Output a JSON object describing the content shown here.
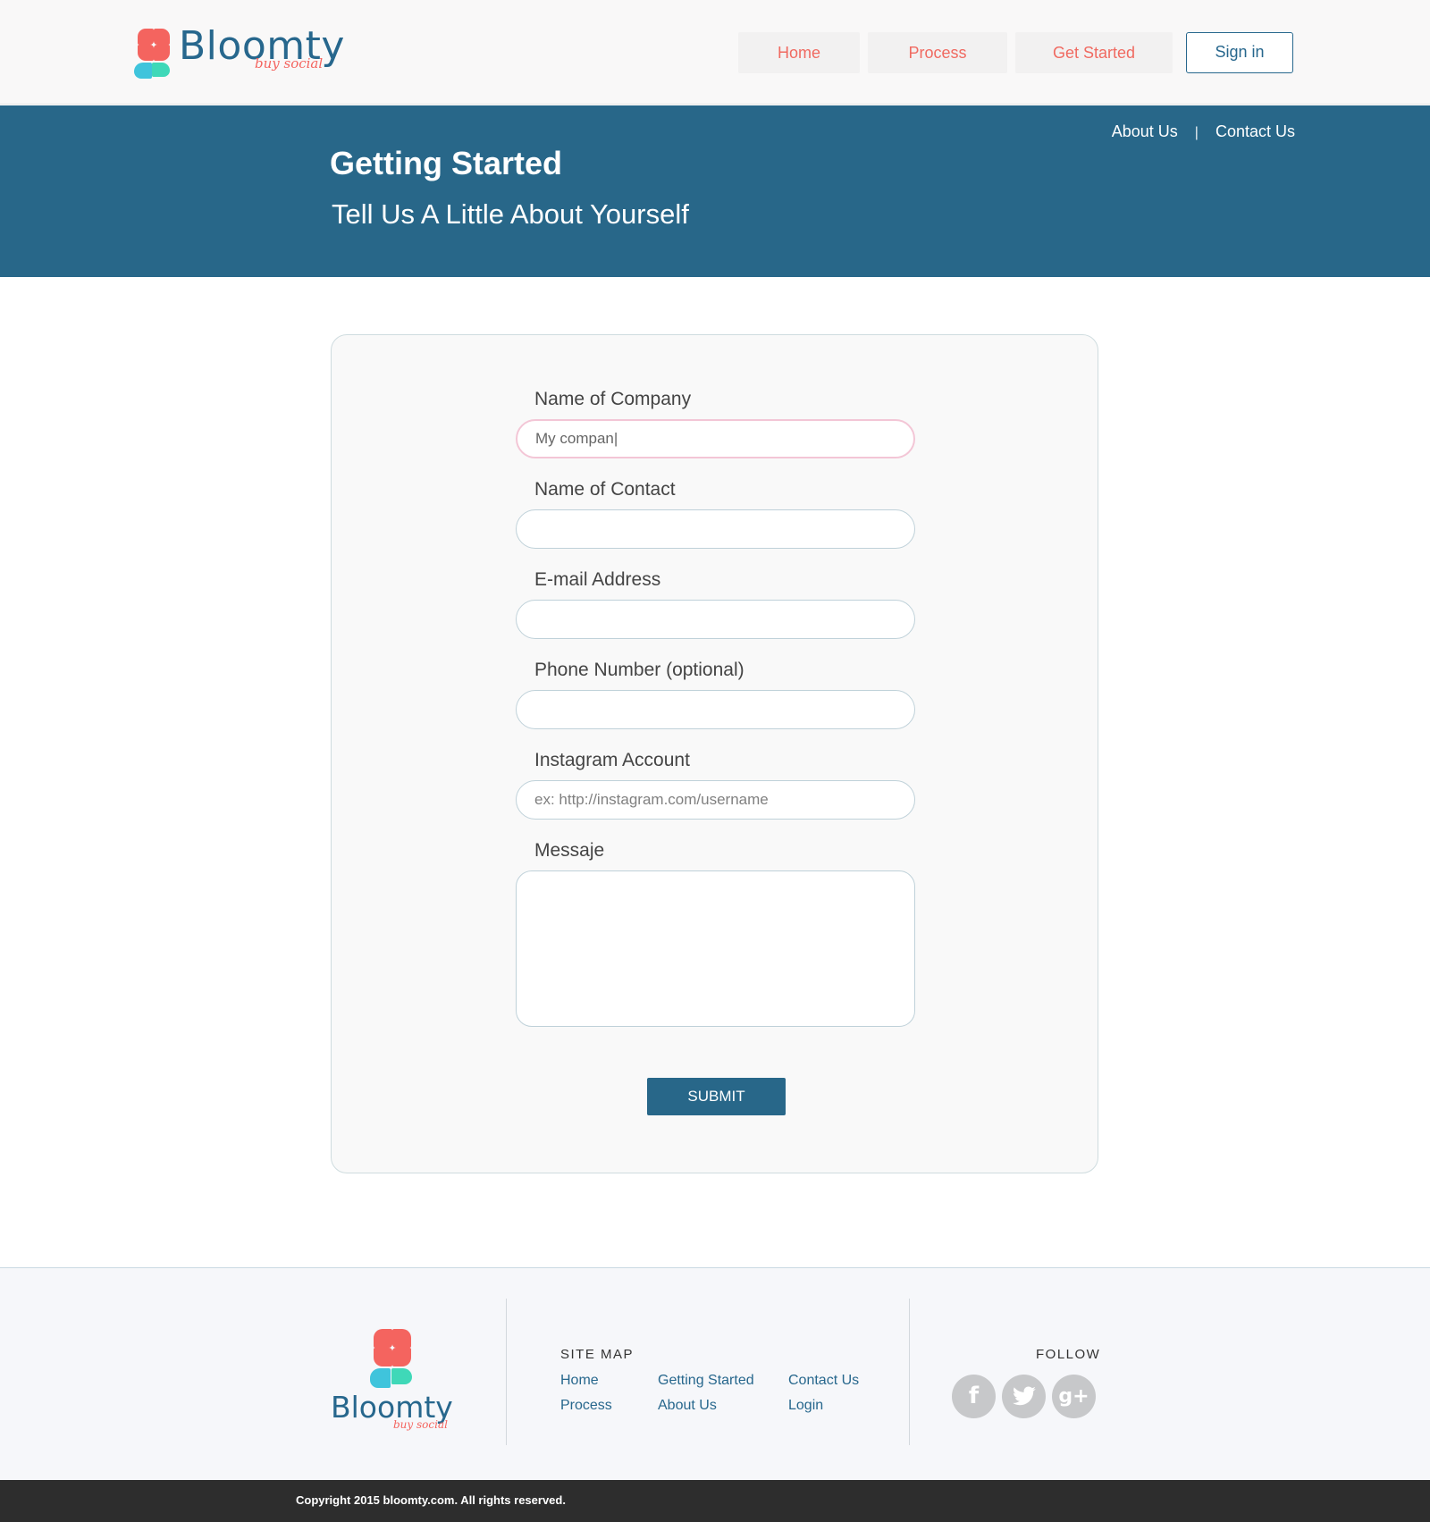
{
  "header": {
    "logo_word": "Bloomty",
    "logo_tagline": "buy social",
    "nav": [
      {
        "label": "Home"
      },
      {
        "label": "Process"
      },
      {
        "label": "Get Started"
      }
    ],
    "signin_label": "Sign in"
  },
  "banner": {
    "links": [
      {
        "label": "About Us"
      },
      {
        "label": "Contact Us"
      }
    ],
    "separator": "|",
    "title": "Getting Started",
    "subtitle": "Tell Us A Little About Yourself"
  },
  "form": {
    "company": {
      "label": "Name of Company",
      "value": "My compan|"
    },
    "contact": {
      "label": "Name of Contact",
      "value": ""
    },
    "email": {
      "label": "E-mail Address",
      "value": ""
    },
    "phone": {
      "label": "Phone Number (optional)",
      "value": ""
    },
    "instagram": {
      "label": "Instagram Account",
      "placeholder": "ex: http://instagram.com/username"
    },
    "message": {
      "label": "Messaje",
      "value": ""
    },
    "submit_label": "SUBMIT"
  },
  "footer": {
    "logo_word": "Bloomty",
    "logo_tagline": "buy social",
    "sitemap_title": "SITE MAP",
    "sitemap_links": [
      {
        "label": "Home"
      },
      {
        "label": "Process"
      },
      {
        "label": "Getting Started"
      },
      {
        "label": "About Us"
      },
      {
        "label": "Contact Us"
      },
      {
        "label": "Login"
      }
    ],
    "follow_title": "FOLLOW",
    "social": [
      {
        "icon": "facebook-icon",
        "glyph": "f"
      },
      {
        "icon": "twitter-icon",
        "glyph": "t"
      },
      {
        "icon": "google-plus-icon",
        "glyph": "g+"
      }
    ],
    "copyright": "Copyright 2015 bloomty.com. All rights reserved."
  },
  "colors": {
    "brand_blue": "#286789",
    "brand_coral": "#f4645f",
    "brand_cyan": "#3fc4dc",
    "brand_mint": "#3fd8b8"
  }
}
